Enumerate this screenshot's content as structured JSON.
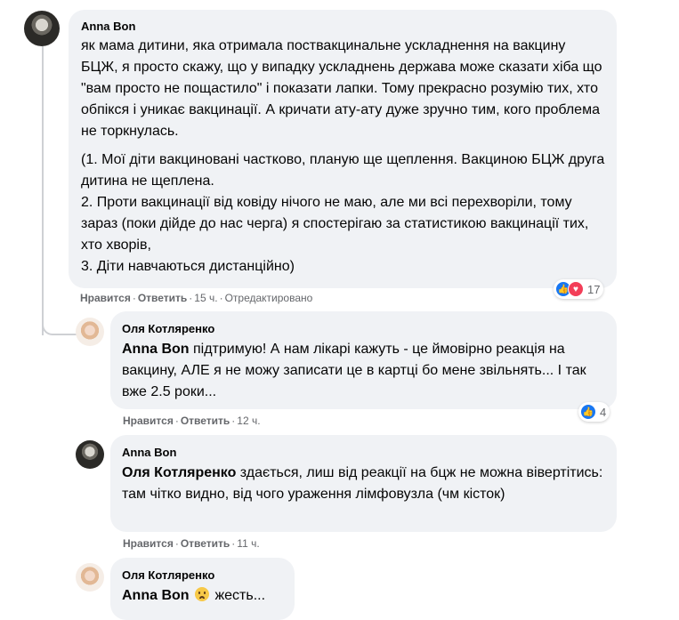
{
  "comments": [
    {
      "author": "Anna Bon",
      "paragraphs": [
        "як мама дитини, яка отримала поствакцинальне ускладнення на вакцину БЦЖ, я просто скажу, що у випадку ускладнень держава може сказати хіба що \"вам просто не пощастило\" і показати лапки. Тому прекрасно розумію тих, хто обпікся і уникає вакцинації. А кричати ату-ату дуже зручно тим, кого проблема не торкнулась.",
        "(1. Мої діти вакциновані частково, планую ще щеплення. Вакциною БЦЖ друга дитина не щеплена.\n2. Проти вакцинації від ковіду нічого не маю, але ми всі перехворіли, тому зараз (поки дійде до нас черга) я спостерігаю за статистикою вакцинації тих, хто хворів,\n3. Діти навчаються дистанційно)"
      ],
      "like": "Нравится",
      "reply": "Ответить",
      "time": "15 ч.",
      "edited": "Отредактировано",
      "reaction_count": "17"
    },
    {
      "author": "Оля Котляренко",
      "mention": "Anna Bon",
      "text": " підтримую! А нам лікарі кажуть - це ймовірно реакція на вакцину, АЛЕ я не можу записати це в картці бо мене звільнять... І так вже 2.5 роки...",
      "like": "Нравится",
      "reply": "Ответить",
      "time": "12 ч.",
      "reaction_count": "4"
    },
    {
      "author": "Anna Bon",
      "mention": "Оля Котляренко",
      "text": " здається, лиш від реакції на бцж не можна вівертітись: там чітко видно, від чого ураження лімфовузла (чм кісток)",
      "like": "Нравится",
      "reply": "Ответить",
      "time": "11 ч."
    },
    {
      "author": "Оля Котляренко",
      "mention": "Anna Bon",
      "emoji": "worried-face-icon",
      "text": " жесть..."
    }
  ],
  "colors": {
    "bubble": "#f0f2f5",
    "meta": "#65676b",
    "like_blue": "#1877f2",
    "love_red": "#f33e58"
  }
}
